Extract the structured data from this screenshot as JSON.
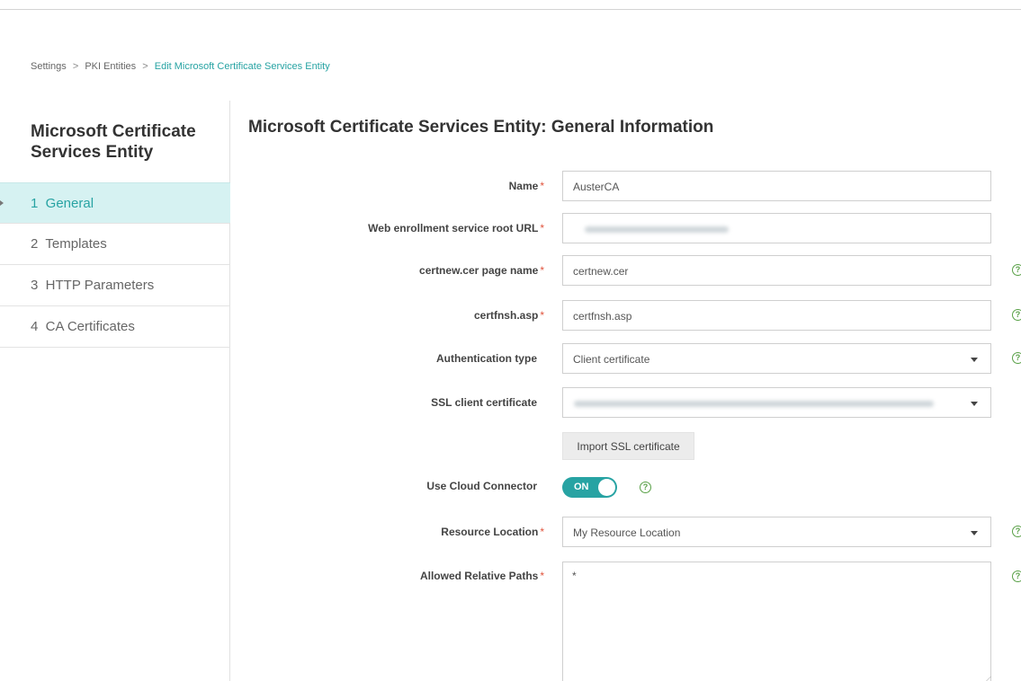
{
  "breadcrumb": {
    "items": [
      "Settings",
      "PKI Entities"
    ],
    "current": "Edit Microsoft Certificate Services Entity",
    "separator": ">"
  },
  "sidebar": {
    "title": "Microsoft Certificate Services Entity",
    "items": [
      {
        "label": "1  General",
        "active": true
      },
      {
        "label": "2  Templates",
        "active": false
      },
      {
        "label": "3  HTTP Parameters",
        "active": false
      },
      {
        "label": "4  CA Certificates",
        "active": false
      }
    ]
  },
  "main": {
    "title": "Microsoft Certificate Services Entity: General Information"
  },
  "form": {
    "name": {
      "label": "Name",
      "value": "AusterCA"
    },
    "root_url": {
      "label": "Web enrollment service root URL",
      "value": ""
    },
    "certnew": {
      "label": "certnew.cer page name",
      "value": "certnew.cer"
    },
    "certfnsh": {
      "label": "certfnsh.asp",
      "value": "certfnsh.asp"
    },
    "auth_type": {
      "label": "Authentication type",
      "value": "Client certificate"
    },
    "ssl_cert": {
      "label": "SSL client certificate",
      "value": ""
    },
    "import_button": "Import SSL certificate",
    "cloud_connector": {
      "label": "Use Cloud Connector",
      "toggle_text": "ON",
      "enabled": true
    },
    "resource_location": {
      "label": "Resource Location",
      "value": "My Resource Location"
    },
    "relative_paths": {
      "label": "Allowed Relative Paths",
      "value": "*"
    },
    "required_mark": "*",
    "help_glyph": "?"
  },
  "colors": {
    "accent": "#27a3a3",
    "active_bg": "#d6f2f2",
    "required": "#e0533c",
    "help": "#58a046"
  },
  "icons": {
    "help": "help-circle-icon",
    "dropdown": "chevron-down-icon",
    "active_marker": "caret-right-icon"
  }
}
